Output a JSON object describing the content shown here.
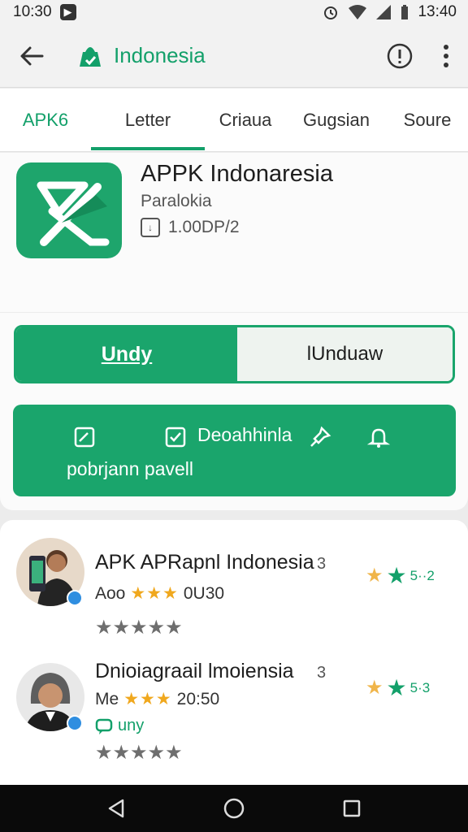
{
  "status_bar": {
    "time_left": "10:30",
    "time_right": "13:40",
    "icons": [
      "app-notification-icon",
      "alarm-icon",
      "wifi-icon",
      "signal-icon",
      "battery-icon"
    ]
  },
  "app_bar": {
    "title": "Indonesia",
    "icons": [
      "back-arrow-icon",
      "store-bag-icon",
      "info-icon",
      "more-vert-icon"
    ]
  },
  "tabs": [
    {
      "label": "APK6",
      "active": false
    },
    {
      "label": "Letter",
      "active": true
    },
    {
      "label": "Criaua",
      "active": false
    },
    {
      "label": "Gugsian",
      "active": false
    },
    {
      "label": "Soure",
      "active": false
    }
  ],
  "app_header": {
    "name": "APPK Indonaresia",
    "subtitle": "Paralokia",
    "size": "1.00DP/2"
  },
  "actions": {
    "primary_label": "Undy",
    "secondary_label": "lUnduaw",
    "feature_label_1": "Deoahhinla",
    "feature_label_2": "pobrjann pavell"
  },
  "reviews": [
    {
      "title": "APK APRapnl Indonesia",
      "count": "3",
      "meta_prefix": "Aoo",
      "gold_stars": "★★★",
      "time": "0U30",
      "grey_stars": "★★★★★",
      "badge_text": "5··2",
      "extra": ""
    },
    {
      "title": "Dnioiagraail lmoiensia",
      "count": "3",
      "meta_prefix": "Me",
      "gold_stars": "★★★",
      "time": "20:50",
      "grey_stars": "★★★★★",
      "badge_text": "5·3",
      "extra": "uny"
    }
  ],
  "colors": {
    "brand_green": "#1aa56c",
    "tab_active": "#13a06a",
    "star_gold": "#f0a81e"
  }
}
